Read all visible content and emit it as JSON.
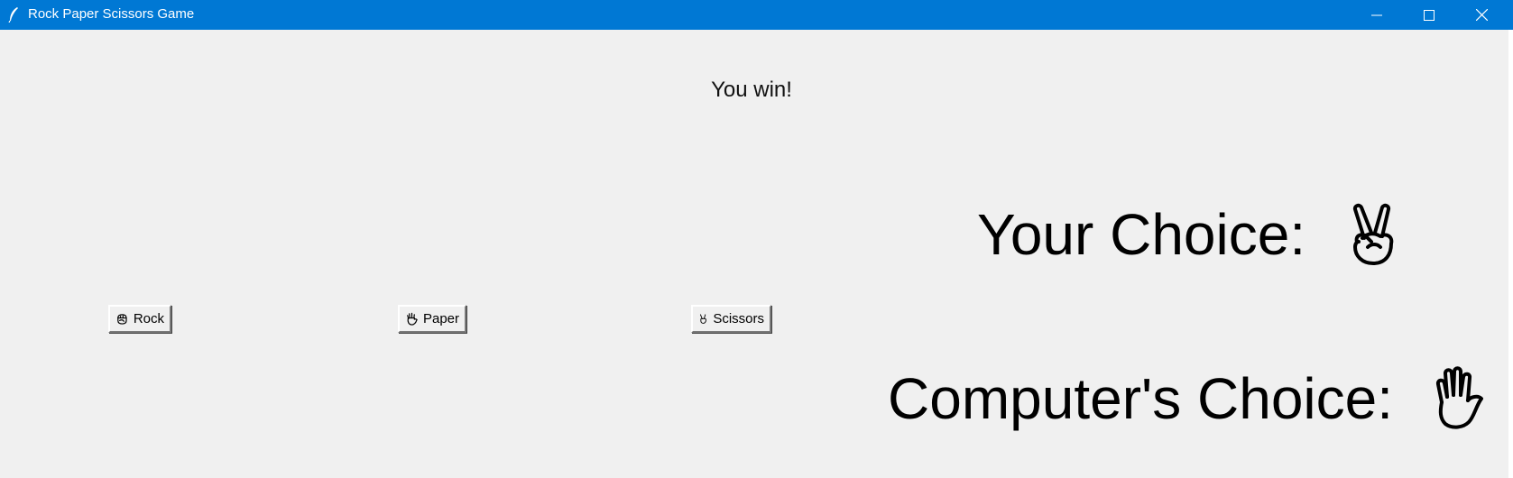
{
  "window": {
    "title": "Rock Paper Scissors Game",
    "title_bar_color": "#0078d4",
    "background_color": "#f0f0f0",
    "icon": "feather-icon",
    "controls": [
      "minimize-icon",
      "maximize-icon",
      "close-icon"
    ]
  },
  "result": {
    "text": "You win!"
  },
  "your_choice": {
    "label": "Your Choice:",
    "icon": "scissors-hand-icon"
  },
  "computer_choice": {
    "label": "Computer's Choice:",
    "icon": "paper-hand-icon"
  },
  "buttons": [
    {
      "label": "Rock",
      "icon": "rock-hand-icon"
    },
    {
      "label": "Paper",
      "icon": "paper-hand-icon"
    },
    {
      "label": "Scissors",
      "icon": "scissors-hand-icon"
    }
  ]
}
